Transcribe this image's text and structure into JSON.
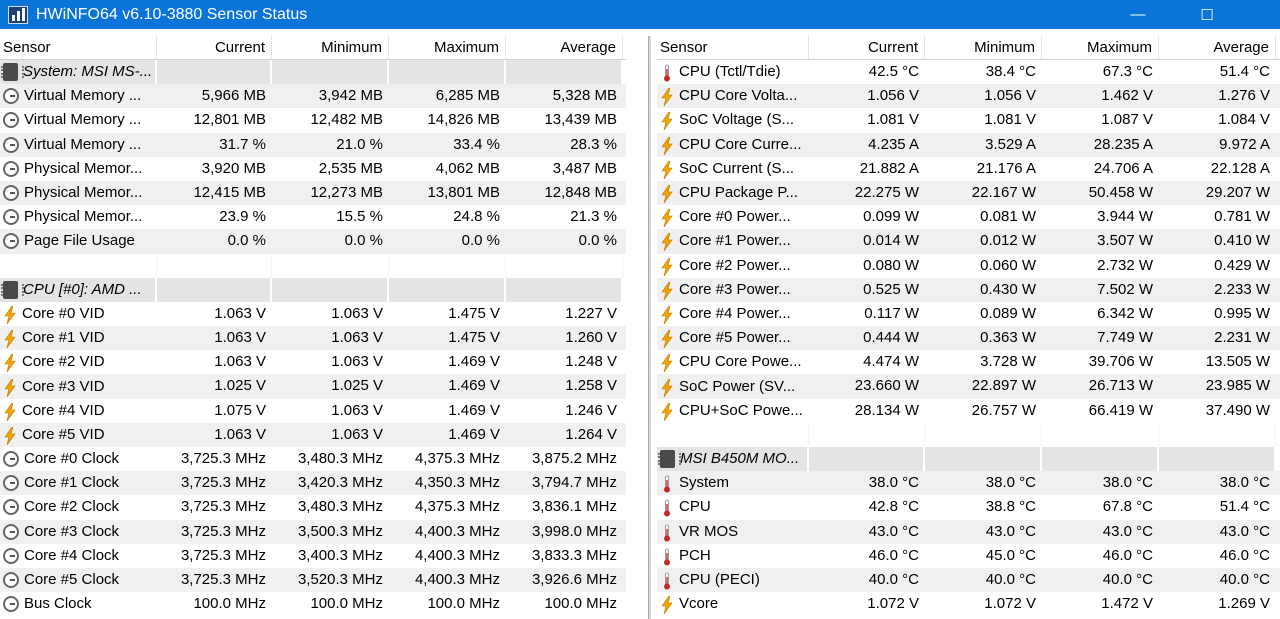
{
  "window": {
    "title": "HWiNFO64 v6.10-3880 Sensor Status",
    "minimize_glyph": "—",
    "maximize_glyph": "☐"
  },
  "columns": [
    "Sensor",
    "Current",
    "Minimum",
    "Maximum",
    "Average"
  ],
  "left_rows": [
    {
      "type": "group",
      "icon": "chip-icon",
      "name": "System: MSI MS-..."
    },
    {
      "type": "sensor",
      "icon": "clock-icon",
      "name": "Virtual Memory ...",
      "current": "5,966 MB",
      "minimum": "3,942 MB",
      "maximum": "6,285 MB",
      "average": "5,328 MB"
    },
    {
      "type": "sensor",
      "icon": "clock-icon",
      "name": "Virtual Memory ...",
      "current": "12,801 MB",
      "minimum": "12,482 MB",
      "maximum": "14,826 MB",
      "average": "13,439 MB"
    },
    {
      "type": "sensor",
      "icon": "clock-icon",
      "name": "Virtual Memory ...",
      "current": "31.7 %",
      "minimum": "21.0 %",
      "maximum": "33.4 %",
      "average": "28.3 %"
    },
    {
      "type": "sensor",
      "icon": "clock-icon",
      "name": "Physical Memor...",
      "current": "3,920 MB",
      "minimum": "2,535 MB",
      "maximum": "4,062 MB",
      "average": "3,487 MB"
    },
    {
      "type": "sensor",
      "icon": "clock-icon",
      "name": "Physical Memor...",
      "current": "12,415 MB",
      "minimum": "12,273 MB",
      "maximum": "13,801 MB",
      "average": "12,848 MB"
    },
    {
      "type": "sensor",
      "icon": "clock-icon",
      "name": "Physical Memor...",
      "current": "23.9 %",
      "minimum": "15.5 %",
      "maximum": "24.8 %",
      "average": "21.3 %"
    },
    {
      "type": "sensor",
      "icon": "clock-icon",
      "name": "Page File Usage",
      "current": "0.0 %",
      "minimum": "0.0 %",
      "maximum": "0.0 %",
      "average": "0.0 %"
    },
    {
      "type": "blank"
    },
    {
      "type": "group",
      "icon": "chip-icon",
      "name": "CPU [#0]: AMD ..."
    },
    {
      "type": "sensor",
      "icon": "bolt-icon",
      "name": "Core #0 VID",
      "current": "1.063 V",
      "minimum": "1.063 V",
      "maximum": "1.475 V",
      "average": "1.227 V"
    },
    {
      "type": "sensor",
      "icon": "bolt-icon",
      "name": "Core #1 VID",
      "current": "1.063 V",
      "minimum": "1.063 V",
      "maximum": "1.475 V",
      "average": "1.260 V"
    },
    {
      "type": "sensor",
      "icon": "bolt-icon",
      "name": "Core #2 VID",
      "current": "1.063 V",
      "minimum": "1.063 V",
      "maximum": "1.469 V",
      "average": "1.248 V"
    },
    {
      "type": "sensor",
      "icon": "bolt-icon",
      "name": "Core #3 VID",
      "current": "1.025 V",
      "minimum": "1.025 V",
      "maximum": "1.469 V",
      "average": "1.258 V"
    },
    {
      "type": "sensor",
      "icon": "bolt-icon",
      "name": "Core #4 VID",
      "current": "1.075 V",
      "minimum": "1.063 V",
      "maximum": "1.469 V",
      "average": "1.246 V"
    },
    {
      "type": "sensor",
      "icon": "bolt-icon",
      "name": "Core #5 VID",
      "current": "1.063 V",
      "minimum": "1.063 V",
      "maximum": "1.469 V",
      "average": "1.264 V"
    },
    {
      "type": "sensor",
      "icon": "clock-icon",
      "name": "Core #0 Clock",
      "current": "3,725.3 MHz",
      "minimum": "3,480.3 MHz",
      "maximum": "4,375.3 MHz",
      "average": "3,875.2 MHz"
    },
    {
      "type": "sensor",
      "icon": "clock-icon",
      "name": "Core #1 Clock",
      "current": "3,725.3 MHz",
      "minimum": "3,420.3 MHz",
      "maximum": "4,350.3 MHz",
      "average": "3,794.7 MHz"
    },
    {
      "type": "sensor",
      "icon": "clock-icon",
      "name": "Core #2 Clock",
      "current": "3,725.3 MHz",
      "minimum": "3,480.3 MHz",
      "maximum": "4,375.3 MHz",
      "average": "3,836.1 MHz"
    },
    {
      "type": "sensor",
      "icon": "clock-icon",
      "name": "Core #3 Clock",
      "current": "3,725.3 MHz",
      "minimum": "3,500.3 MHz",
      "maximum": "4,400.3 MHz",
      "average": "3,998.0 MHz"
    },
    {
      "type": "sensor",
      "icon": "clock-icon",
      "name": "Core #4 Clock",
      "current": "3,725.3 MHz",
      "minimum": "3,400.3 MHz",
      "maximum": "4,400.3 MHz",
      "average": "3,833.3 MHz"
    },
    {
      "type": "sensor",
      "icon": "clock-icon",
      "name": "Core #5 Clock",
      "current": "3,725.3 MHz",
      "minimum": "3,520.3 MHz",
      "maximum": "4,400.3 MHz",
      "average": "3,926.6 MHz"
    },
    {
      "type": "sensor",
      "icon": "clock-icon",
      "name": "Bus Clock",
      "current": "100.0 MHz",
      "minimum": "100.0 MHz",
      "maximum": "100.0 MHz",
      "average": "100.0 MHz"
    }
  ],
  "right_rows": [
    {
      "type": "sensor",
      "icon": "thermometer-icon",
      "name": "CPU (Tctl/Tdie)",
      "current": "42.5 °C",
      "minimum": "38.4 °C",
      "maximum": "67.3 °C",
      "average": "51.4 °C"
    },
    {
      "type": "sensor",
      "icon": "bolt-icon",
      "name": "CPU Core Volta...",
      "current": "1.056 V",
      "minimum": "1.056 V",
      "maximum": "1.462 V",
      "average": "1.276 V"
    },
    {
      "type": "sensor",
      "icon": "bolt-icon",
      "name": "SoC Voltage (S...",
      "current": "1.081 V",
      "minimum": "1.081 V",
      "maximum": "1.087 V",
      "average": "1.084 V"
    },
    {
      "type": "sensor",
      "icon": "bolt-icon",
      "name": "CPU Core Curre...",
      "current": "4.235 A",
      "minimum": "3.529 A",
      "maximum": "28.235 A",
      "average": "9.972 A"
    },
    {
      "type": "sensor",
      "icon": "bolt-icon",
      "name": "SoC Current (S...",
      "current": "21.882 A",
      "minimum": "21.176 A",
      "maximum": "24.706 A",
      "average": "22.128 A"
    },
    {
      "type": "sensor",
      "icon": "bolt-icon",
      "name": "CPU Package P...",
      "current": "22.275 W",
      "minimum": "22.167 W",
      "maximum": "50.458 W",
      "average": "29.207 W"
    },
    {
      "type": "sensor",
      "icon": "bolt-icon",
      "name": "Core #0 Power...",
      "current": "0.099 W",
      "minimum": "0.081 W",
      "maximum": "3.944 W",
      "average": "0.781 W"
    },
    {
      "type": "sensor",
      "icon": "bolt-icon",
      "name": "Core #1 Power...",
      "current": "0.014 W",
      "minimum": "0.012 W",
      "maximum": "3.507 W",
      "average": "0.410 W"
    },
    {
      "type": "sensor",
      "icon": "bolt-icon",
      "name": "Core #2 Power...",
      "current": "0.080 W",
      "minimum": "0.060 W",
      "maximum": "2.732 W",
      "average": "0.429 W"
    },
    {
      "type": "sensor",
      "icon": "bolt-icon",
      "name": "Core #3 Power...",
      "current": "0.525 W",
      "minimum": "0.430 W",
      "maximum": "7.502 W",
      "average": "2.233 W"
    },
    {
      "type": "sensor",
      "icon": "bolt-icon",
      "name": "Core #4 Power...",
      "current": "0.117 W",
      "minimum": "0.089 W",
      "maximum": "6.342 W",
      "average": "0.995 W"
    },
    {
      "type": "sensor",
      "icon": "bolt-icon",
      "name": "Core #5 Power...",
      "current": "0.444 W",
      "minimum": "0.363 W",
      "maximum": "7.749 W",
      "average": "2.231 W"
    },
    {
      "type": "sensor",
      "icon": "bolt-icon",
      "name": "CPU Core Powe...",
      "current": "4.474 W",
      "minimum": "3.728 W",
      "maximum": "39.706 W",
      "average": "13.505 W"
    },
    {
      "type": "sensor",
      "icon": "bolt-icon",
      "name": "SoC Power (SV...",
      "current": "23.660 W",
      "minimum": "22.897 W",
      "maximum": "26.713 W",
      "average": "23.985 W"
    },
    {
      "type": "sensor",
      "icon": "bolt-icon",
      "name": "CPU+SoC Powe...",
      "current": "28.134 W",
      "minimum": "26.757 W",
      "maximum": "66.419 W",
      "average": "37.490 W"
    },
    {
      "type": "blank"
    },
    {
      "type": "group",
      "icon": "chip-icon",
      "name": "MSI B450M MO..."
    },
    {
      "type": "sensor",
      "icon": "thermometer-icon",
      "name": "System",
      "current": "38.0 °C",
      "minimum": "38.0 °C",
      "maximum": "38.0 °C",
      "average": "38.0 °C"
    },
    {
      "type": "sensor",
      "icon": "thermometer-icon",
      "name": "CPU",
      "current": "42.8 °C",
      "minimum": "38.8 °C",
      "maximum": "67.8 °C",
      "average": "51.4 °C"
    },
    {
      "type": "sensor",
      "icon": "thermometer-icon",
      "name": "VR MOS",
      "current": "43.0 °C",
      "minimum": "43.0 °C",
      "maximum": "43.0 °C",
      "average": "43.0 °C"
    },
    {
      "type": "sensor",
      "icon": "thermometer-icon",
      "name": "PCH",
      "current": "46.0 °C",
      "minimum": "45.0 °C",
      "maximum": "46.0 °C",
      "average": "46.0 °C"
    },
    {
      "type": "sensor",
      "icon": "thermometer-icon",
      "name": "CPU (PECI)",
      "current": "40.0 °C",
      "minimum": "40.0 °C",
      "maximum": "40.0 °C",
      "average": "40.0 °C"
    },
    {
      "type": "sensor",
      "icon": "bolt-icon",
      "name": "Vcore",
      "current": "1.072 V",
      "minimum": "1.072 V",
      "maximum": "1.472 V",
      "average": "1.269 V"
    }
  ],
  "colors": {
    "titlebar": "#0a74d9",
    "alt_row": "#f0f0f0",
    "group_row": "#e4e4e4",
    "bolt": "#f5a300",
    "thermometer": "#c62828"
  }
}
